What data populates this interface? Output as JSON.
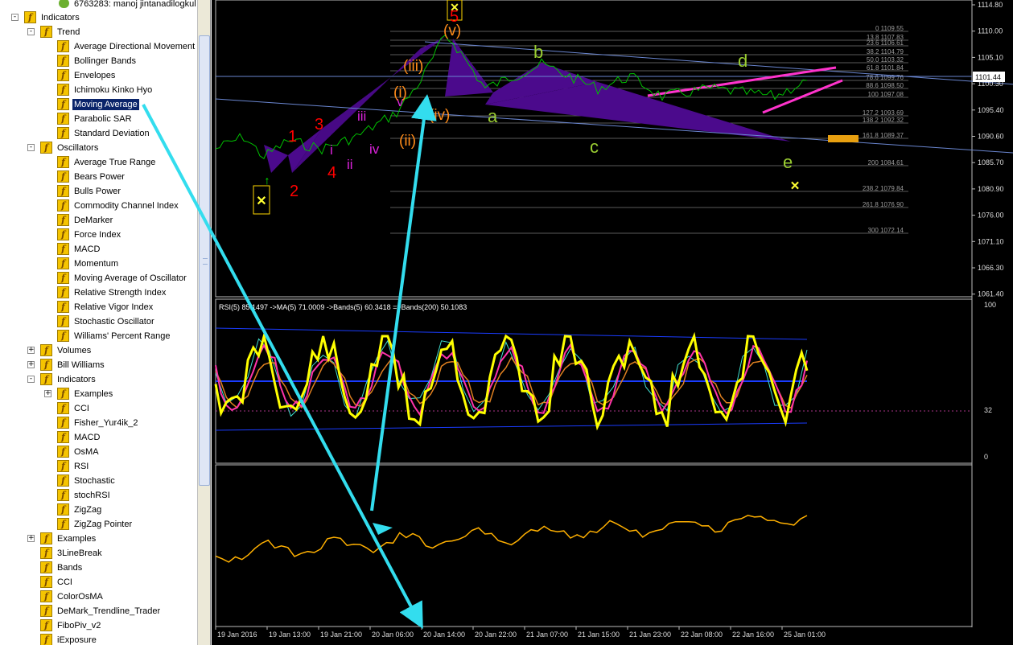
{
  "navigator": {
    "top_item": "6763283: manoj jintanadilogkul",
    "items": [
      {
        "label": "Indicators",
        "level": 0,
        "exp": "-",
        "icon": "indicator-folder-icon"
      },
      {
        "label": "Trend",
        "level": 1,
        "exp": "-",
        "icon": "indicator-folder-icon"
      },
      {
        "label": "Average Directional Movement",
        "level": 2,
        "icon": "indicator-icon"
      },
      {
        "label": "Bollinger Bands",
        "level": 2,
        "icon": "indicator-icon"
      },
      {
        "label": "Envelopes",
        "level": 2,
        "icon": "indicator-icon"
      },
      {
        "label": "Ichimoku Kinko Hyo",
        "level": 2,
        "icon": "indicator-icon"
      },
      {
        "label": "Moving Average",
        "level": 2,
        "icon": "indicator-icon",
        "selected": true
      },
      {
        "label": "Parabolic SAR",
        "level": 2,
        "icon": "indicator-icon"
      },
      {
        "label": "Standard Deviation",
        "level": 2,
        "icon": "indicator-icon"
      },
      {
        "label": "Oscillators",
        "level": 1,
        "exp": "-",
        "icon": "indicator-folder-icon"
      },
      {
        "label": "Average True Range",
        "level": 2,
        "icon": "indicator-icon"
      },
      {
        "label": "Bears Power",
        "level": 2,
        "icon": "indicator-icon"
      },
      {
        "label": "Bulls Power",
        "level": 2,
        "icon": "indicator-icon"
      },
      {
        "label": "Commodity Channel Index",
        "level": 2,
        "icon": "indicator-icon"
      },
      {
        "label": "DeMarker",
        "level": 2,
        "icon": "indicator-icon"
      },
      {
        "label": "Force Index",
        "level": 2,
        "icon": "indicator-icon"
      },
      {
        "label": "MACD",
        "level": 2,
        "icon": "indicator-icon"
      },
      {
        "label": "Momentum",
        "level": 2,
        "icon": "indicator-icon"
      },
      {
        "label": "Moving Average of Oscillator",
        "level": 2,
        "icon": "indicator-icon"
      },
      {
        "label": "Relative Strength Index",
        "level": 2,
        "icon": "indicator-icon"
      },
      {
        "label": "Relative Vigor Index",
        "level": 2,
        "icon": "indicator-icon"
      },
      {
        "label": "Stochastic Oscillator",
        "level": 2,
        "icon": "indicator-icon"
      },
      {
        "label": "Williams' Percent Range",
        "level": 2,
        "icon": "indicator-icon"
      },
      {
        "label": "Volumes",
        "level": 1,
        "exp": "+",
        "icon": "indicator-folder-icon"
      },
      {
        "label": "Bill Williams",
        "level": 1,
        "exp": "+",
        "icon": "indicator-folder-icon"
      },
      {
        "label": "Indicators",
        "level": 1,
        "exp": "-",
        "icon": "indicator-folder-icon"
      },
      {
        "label": "Examples",
        "level": 2,
        "exp": "+",
        "icon": "custom-folder-icon"
      },
      {
        "label": "CCI",
        "level": 2,
        "icon": "custom-indicator-icon"
      },
      {
        "label": "Fisher_Yur4ik_2",
        "level": 2,
        "icon": "custom-indicator-icon"
      },
      {
        "label": "MACD",
        "level": 2,
        "icon": "custom-indicator-icon"
      },
      {
        "label": "OsMA",
        "level": 2,
        "icon": "custom-indicator-icon"
      },
      {
        "label": "RSI",
        "level": 2,
        "icon": "custom-indicator-icon"
      },
      {
        "label": "Stochastic",
        "level": 2,
        "icon": "custom-indicator-icon"
      },
      {
        "label": "stochRSI",
        "level": 2,
        "icon": "custom-indicator-icon"
      },
      {
        "label": "ZigZag",
        "level": 2,
        "icon": "custom-indicator-icon"
      },
      {
        "label": "ZigZag Pointer",
        "level": 2,
        "icon": "custom-indicator-icon"
      },
      {
        "label": "Examples",
        "level": 1,
        "exp": "+",
        "icon": "custom-folder-icon"
      },
      {
        "label": "3LineBreak",
        "level": 1,
        "icon": "custom-indicator-icon"
      },
      {
        "label": "Bands",
        "level": 1,
        "icon": "custom-indicator-icon"
      },
      {
        "label": "CCI",
        "level": 1,
        "icon": "custom-indicator-icon"
      },
      {
        "label": "ColorOsMA",
        "level": 1,
        "icon": "custom-indicator-icon"
      },
      {
        "label": "DeMark_Trendline_Trader",
        "level": 1,
        "icon": "custom-indicator-icon"
      },
      {
        "label": "FiboPiv_v2",
        "level": 1,
        "icon": "custom-indicator-icon"
      },
      {
        "label": "iExposure",
        "level": 1,
        "icon": "custom-indicator-icon"
      }
    ]
  },
  "chart": {
    "price_axis": [
      "1114.80",
      "1110.00",
      "1105.10",
      "1100.30",
      "1095.40",
      "1090.60",
      "1085.70",
      "1080.90",
      "1076.00",
      "1071.10",
      "1066.30",
      "1061.40"
    ],
    "current_price": "1101.44",
    "fibo_levels": [
      "0 1109.55",
      "13.8 1107.83",
      "23.6 1106.61",
      "38.2 1104.79",
      "50.0 1103.32",
      "61.8 1101.84",
      "78.6 1099.76",
      "88.6 1098.50",
      "100 1097.08",
      "127.2 1093.69",
      "138.2 1092.32",
      "161.8 1089.37",
      "200 1084.61",
      "238.2 1079.84",
      "261.8 1076.90",
      "300 1072.14"
    ],
    "wave_labels": {
      "w1": "1",
      "w2": "2",
      "w3": "3",
      "w4": "4",
      "w5": "5",
      "i": "i",
      "ii": "ii",
      "iii": "iii",
      "iv": "iv",
      "v": "v",
      "pi": "(i)",
      "pii": "(ii)",
      "piii": "(iii)",
      "piv": "(iv)",
      "pv": "(v)",
      "a": "a",
      "b": "b",
      "c": "c",
      "d": "d",
      "e": "e"
    },
    "rsi_label": "RSI(5) 85.1497  ->MA(5) 71.0009  ->Bands(5) 60.3418  =>Bands(200) 50.1083",
    "rsi_axis": [
      "100",
      "32",
      "0"
    ],
    "time_axis": [
      "19 Jan 2016",
      "19 Jan 13:00",
      "19 Jan 21:00",
      "20 Jan 06:00",
      "20 Jan 14:00",
      "20 Jan 22:00",
      "21 Jan 07:00",
      "21 Jan 15:00",
      "21 Jan 23:00",
      "22 Jan 08:00",
      "22 Jan 16:00",
      "25 Jan 01:00"
    ],
    "colors": {
      "background": "#000000",
      "price_line": "#00c000",
      "wave_fill": "#4b0a8c",
      "rsi": "#ffff00",
      "arrows": "#33ddee",
      "fibo": "#778899",
      "lower_line": "#ffb000",
      "magenta": "#ff33cc"
    }
  }
}
